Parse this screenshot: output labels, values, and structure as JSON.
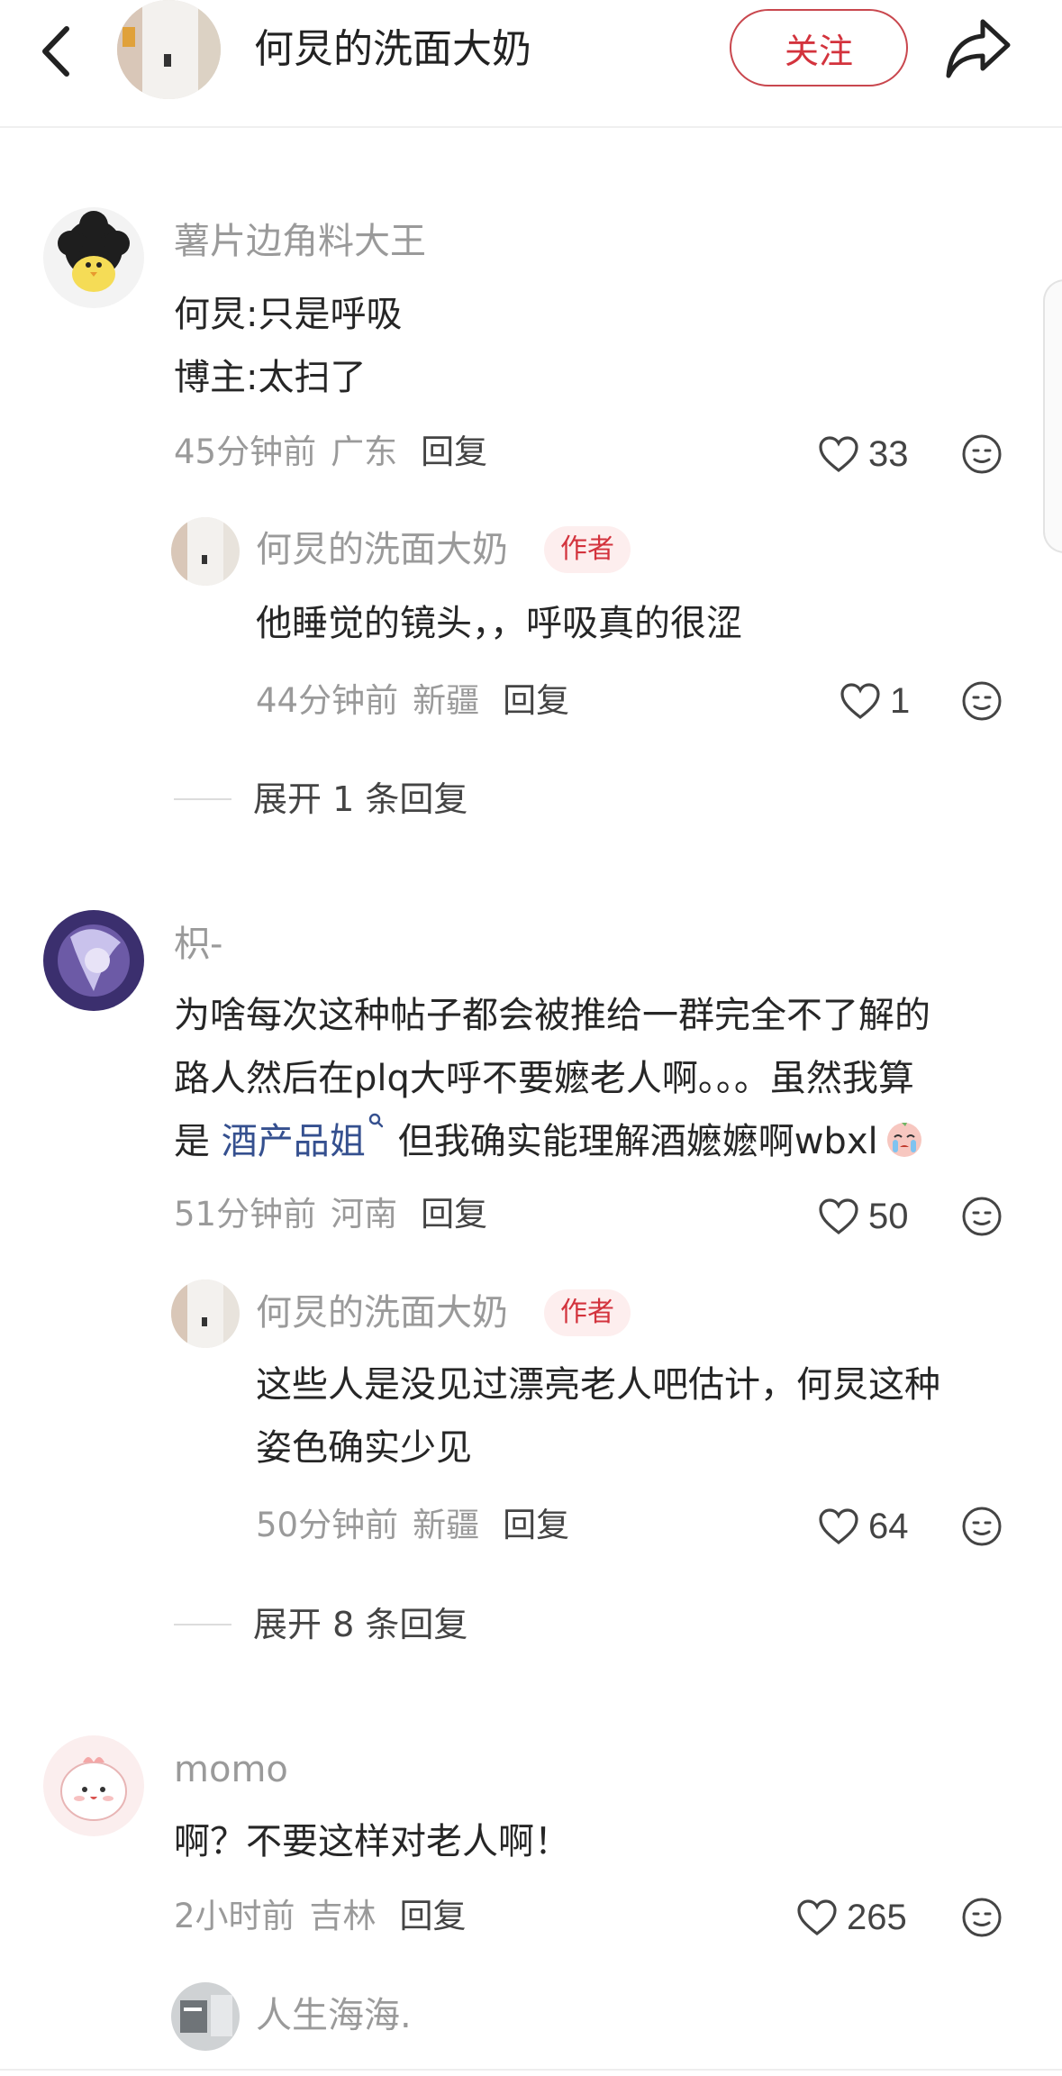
{
  "header": {
    "title": "何炅的洗面大奶",
    "follow_label": "关注"
  },
  "comments": [
    {
      "user": "薯片边角料大王",
      "lines": [
        "何炅:只是呼吸",
        "博主:太扫了"
      ],
      "time": "45分钟前",
      "location": "广东",
      "reply_label": "回复",
      "likes": "33",
      "replies": [
        {
          "user": "何炅的洗面大奶",
          "badge": "作者",
          "lines": [
            "他睡觉的镜头，，呼吸真的很涩"
          ],
          "time": "44分钟前",
          "location": "新疆",
          "reply_label": "回复",
          "likes": "1"
        }
      ],
      "expand_label": "展开 1 条回复"
    },
    {
      "user": "枳-",
      "lines": [
        "为啥每次这种帖子都会被推给一群完全不了解的",
        "路人然后在plq大呼不要嬷老人啊。。。虽然我算"
      ],
      "line3_prefix": "是 ",
      "line3_link": "酒产品姐",
      "line3_suffix": "但我确实能理解酒嬷嬷啊wbxl",
      "time": "51分钟前",
      "location": "河南",
      "reply_label": "回复",
      "likes": "50",
      "replies": [
        {
          "user": "何炅的洗面大奶",
          "badge": "作者",
          "lines": [
            "这些人是没见过漂亮老人吧估计，何炅这种",
            "姿色确实少见"
          ],
          "time": "50分钟前",
          "location": "新疆",
          "reply_label": "回复",
          "likes": "64"
        }
      ],
      "expand_label": "展开 8 条回复"
    },
    {
      "user": "momo",
      "lines": [
        "啊？不要这样对老人啊！"
      ],
      "time": "2小时前",
      "location": "吉林",
      "reply_label": "回复",
      "likes": "265",
      "replies": [
        {
          "user": "人生海海."
        }
      ]
    }
  ],
  "colors": {
    "accent": "#d3333d",
    "link": "#35508f",
    "muted": "#9a9a9a"
  },
  "icons": [
    "back-arrow-icon",
    "share-icon",
    "heart-icon",
    "emoji-icon",
    "search-icon"
  ]
}
